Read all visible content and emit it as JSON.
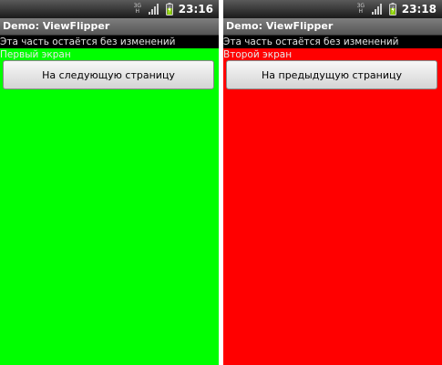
{
  "screens": [
    {
      "status": {
        "time": "23:16",
        "network_label": [
          "3G",
          "H"
        ]
      },
      "title": "Demo: ViewFlipper",
      "static_text": "Эта часть остаётся без изменений",
      "flipper": {
        "label": "Первый экран",
        "button": "На следующую страницу",
        "background": "#00ff00"
      }
    },
    {
      "status": {
        "time": "23:18",
        "network_label": [
          "3G",
          "H"
        ]
      },
      "title": "Demo: ViewFlipper",
      "static_text": "Эта часть остаётся без изменений",
      "flipper": {
        "label": "Второй экран",
        "button": "На предыдущую страницу",
        "background": "#ff0000"
      }
    }
  ],
  "icons": {
    "network": "network-type-icon",
    "signal": "signal-strength-icon",
    "battery": "battery-charging-icon"
  },
  "colors": {
    "status_bar": "#2a2a2a",
    "title_bar": "#6b6b6b",
    "battery_fill": "#8fd400"
  }
}
